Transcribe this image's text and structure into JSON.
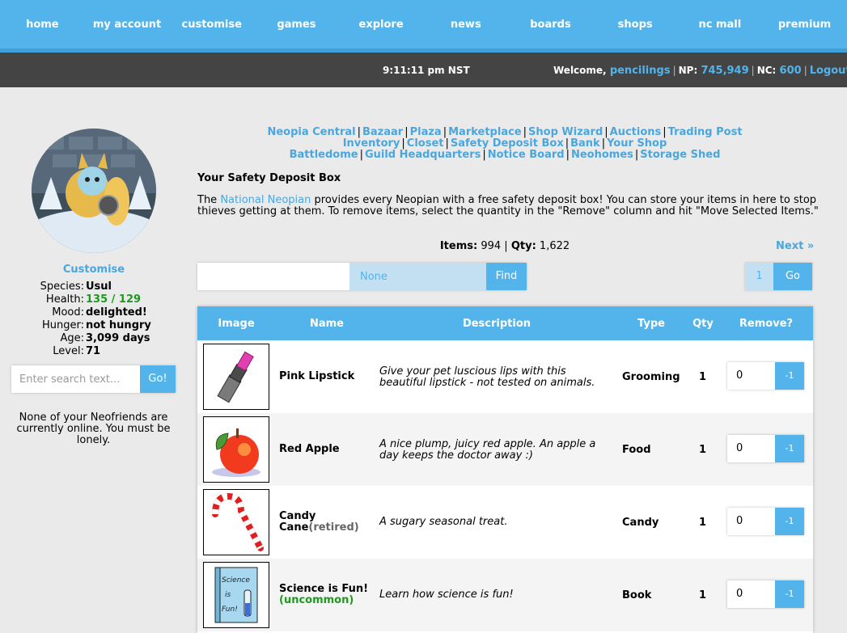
{
  "nav": [
    "home",
    "my account",
    "customise",
    "games",
    "explore",
    "news",
    "boards",
    "shops",
    "nc mall",
    "premium"
  ],
  "subbar": {
    "clock": "9:11:11 pm NST",
    "welcome_label": "Welcome,",
    "username": "pencilings",
    "np_label": "NP:",
    "np_value": "745,949",
    "nc_label": "NC:",
    "nc_value": "600",
    "logout": "Logout"
  },
  "sidebar": {
    "customise": "Customise",
    "stats": [
      {
        "label": "Species:",
        "value": "Usul"
      },
      {
        "label": "Health:",
        "value": "135 / 129"
      },
      {
        "label": "Mood:",
        "value": "delighted!"
      },
      {
        "label": "Hunger:",
        "value": "not hungry"
      },
      {
        "label": "Age:",
        "value": "3,099 days"
      },
      {
        "label": "Level:",
        "value": "71"
      }
    ],
    "search_placeholder": "Enter search text...",
    "search_button": "Go!",
    "friends_note": "None of your Neofriends are currently online. You must be lonely."
  },
  "quicklinks": {
    "row1": [
      "Neopia Central",
      "Bazaar",
      "Plaza",
      "Marketplace",
      "Shop Wizard",
      "Auctions",
      "Trading Post"
    ],
    "row2": [
      "Inventory",
      "Closet",
      "Safety Deposit Box",
      "Bank",
      "Your Shop"
    ],
    "row3": [
      "Battledome",
      "Guild Headquarters",
      "Notice Board",
      "Neohomes",
      "Storage Shed"
    ]
  },
  "main": {
    "title": "Your Safety Deposit Box",
    "intro_pre": "The ",
    "intro_link": "National Neopian",
    "intro_post": " provides every Neopian with a free safety deposit box! You can store your items in here to stop thieves getting at them. To remove items, select the quantity in the \"Remove\" column and hit \"Move Selected Items.\"",
    "items_label": "Items:",
    "items_value": "994",
    "qty_label": "Qty:",
    "qty_value": "1,622",
    "next": "Next »",
    "category_select": "None",
    "find_button": "Find",
    "page_value": "1",
    "go_button": "Go"
  },
  "table": {
    "headers": [
      "Image",
      "Name",
      "Description",
      "Type",
      "Qty",
      "Remove?"
    ],
    "rows": [
      {
        "name": "Pink Lipstick",
        "tag": "",
        "description": "Give your pet luscious lips with this beautiful lipstick - not tested on animals.",
        "type": "Grooming",
        "qty": "1",
        "remove": "0",
        "dec": "-1"
      },
      {
        "name": "Red Apple",
        "tag": "",
        "description": "A nice plump, juicy red apple. An apple a day keeps the doctor away :)",
        "type": "Food",
        "qty": "1",
        "remove": "0",
        "dec": "-1"
      },
      {
        "name": "Candy Cane",
        "tag": "(retired)",
        "description": "A sugary seasonal treat.",
        "type": "Candy",
        "qty": "1",
        "remove": "0",
        "dec": "-1"
      },
      {
        "name": "Science is Fun!",
        "tag": "(uncommon)",
        "description": "Learn how science is fun!",
        "type": "Book",
        "qty": "1",
        "remove": "0",
        "dec": "-1"
      }
    ]
  },
  "book_cover_text": [
    "Science",
    "is",
    "Fun!"
  ]
}
